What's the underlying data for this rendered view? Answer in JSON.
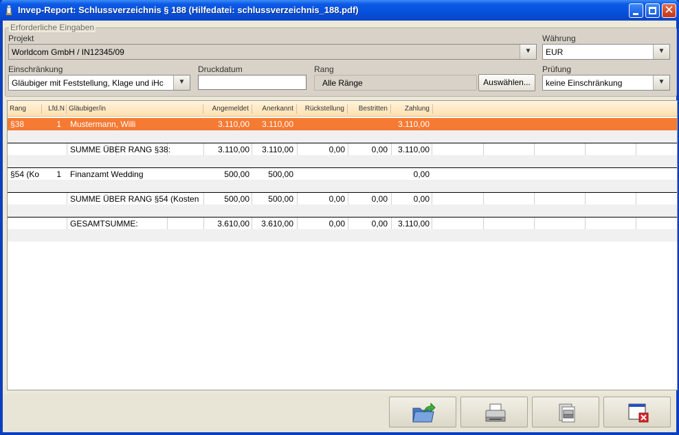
{
  "window": {
    "title": "Invep-Report: Schlussverzeichnis § 188   (Hilfedatei: schlussverzeichnis_188.pdf)"
  },
  "form": {
    "group_title": "Erforderliche Eingaben",
    "projekt_label": "Projekt",
    "projekt_value": "Worldcom GmbH / IN12345/09",
    "waehrung_label": "Währung",
    "waehrung_value": "EUR",
    "einschraenkung_label": "Einschränkung",
    "einschraenkung_value": "Gläubiger mit Feststellung, Klage und iHc",
    "druckdatum_label": "Druckdatum",
    "druckdatum_value": "",
    "rang_label": "Rang",
    "rang_value": "Alle Ränge",
    "auswaehlen_label": "Auswählen...",
    "pruefung_label": "Prüfung",
    "pruefung_value": "keine Einschränkung"
  },
  "table": {
    "headers": [
      "Rang",
      "Lfd.N",
      "Gläubiger/in",
      "Angemeldet",
      "Anerkannt",
      "Rückstellung",
      "Bestritten",
      "Zahlung"
    ],
    "rows": [
      {
        "rang": "§38",
        "lfd": "1",
        "glaeubiger": "Mustermann, Willi",
        "angemeldet": "3.110,00",
        "anerkannt": "3.110,00",
        "rueckstellung": "",
        "bestritten": "",
        "zahlung": "3.110,00"
      },
      {
        "rang": "",
        "lfd": "",
        "glaeubiger": "SUMME ÜBER RANG §38:",
        "angemeldet": "3.110,00",
        "anerkannt": "3.110,00",
        "rueckstellung": "0,00",
        "bestritten": "0,00",
        "zahlung": "3.110,00"
      },
      {
        "rang": "§54 (Ko",
        "lfd": "1",
        "glaeubiger": "Finanzamt Wedding",
        "angemeldet": "500,00",
        "anerkannt": "500,00",
        "rueckstellung": "",
        "bestritten": "",
        "zahlung": "0,00"
      },
      {
        "rang": "",
        "lfd": "",
        "glaeubiger": "SUMME ÜBER RANG §54 (Kosten",
        "angemeldet": "500,00",
        "anerkannt": "500,00",
        "rueckstellung": "0,00",
        "bestritten": "0,00",
        "zahlung": "0,00"
      },
      {
        "rang": "",
        "lfd": "",
        "glaeubiger": "GESAMTSUMME:",
        "angemeldet": "3.610,00",
        "anerkannt": "3.610,00",
        "rueckstellung": "0,00",
        "bestritten": "0,00",
        "zahlung": "3.110,00"
      }
    ]
  },
  "toolbar": {
    "buttons": [
      "export-icon",
      "print-icon",
      "print-preview-icon",
      "close-window-icon"
    ]
  },
  "colors": {
    "selected_row": "#f57a33",
    "header_bg": "#ffe0b0",
    "titlebar": "#0650dc"
  }
}
